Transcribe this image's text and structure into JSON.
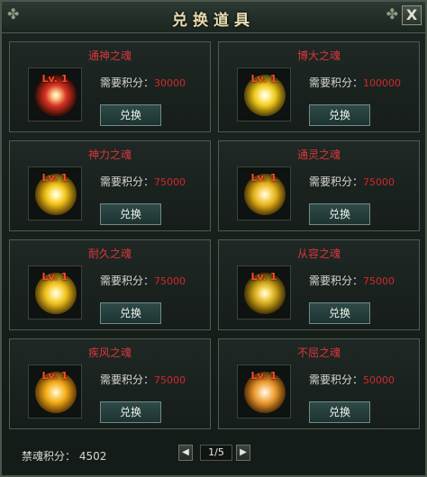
{
  "window": {
    "title": "兑换道具",
    "close_label": "X"
  },
  "items": [
    {
      "name": "通神之魂",
      "level": "Lv. 1",
      "requirement_label": "需要积分：",
      "points": "30000",
      "button_label": "兑换",
      "orb_color": "#d83222"
    },
    {
      "name": "博大之魂",
      "level": "Lv. 1",
      "requirement_label": "需要积分：",
      "points": "100000",
      "button_label": "兑换",
      "orb_color": "#f0c81a"
    },
    {
      "name": "神力之魂",
      "level": "Lv. 1",
      "requirement_label": "需要积分：",
      "points": "75000",
      "button_label": "兑换",
      "orb_color": "#f3c319"
    },
    {
      "name": "通灵之魂",
      "level": "Lv. 1",
      "requirement_label": "需要积分：",
      "points": "75000",
      "button_label": "兑换",
      "orb_color": "#e5b019"
    },
    {
      "name": "耐久之魂",
      "level": "Lv. 1",
      "requirement_label": "需要积分：",
      "points": "75000",
      "button_label": "兑换",
      "orb_color": "#efc01c"
    },
    {
      "name": "从容之魂",
      "level": "Lv. 1",
      "requirement_label": "需要积分：",
      "points": "75000",
      "button_label": "兑换",
      "orb_color": "#c9a316"
    },
    {
      "name": "疾风之魂",
      "level": "Lv. 1",
      "requirement_label": "需要积分：",
      "points": "75000",
      "button_label": "兑换",
      "orb_color": "#f2a816"
    },
    {
      "name": "不屈之魂",
      "level": "Lv. 1",
      "requirement_label": "需要积分：",
      "points": "50000",
      "button_label": "兑换",
      "orb_color": "#e8952a"
    }
  ],
  "footer": {
    "score_label": "禁魂积分：",
    "score_value": "4502",
    "page": "1/5",
    "prev_label": "◀",
    "next_label": "▶"
  }
}
